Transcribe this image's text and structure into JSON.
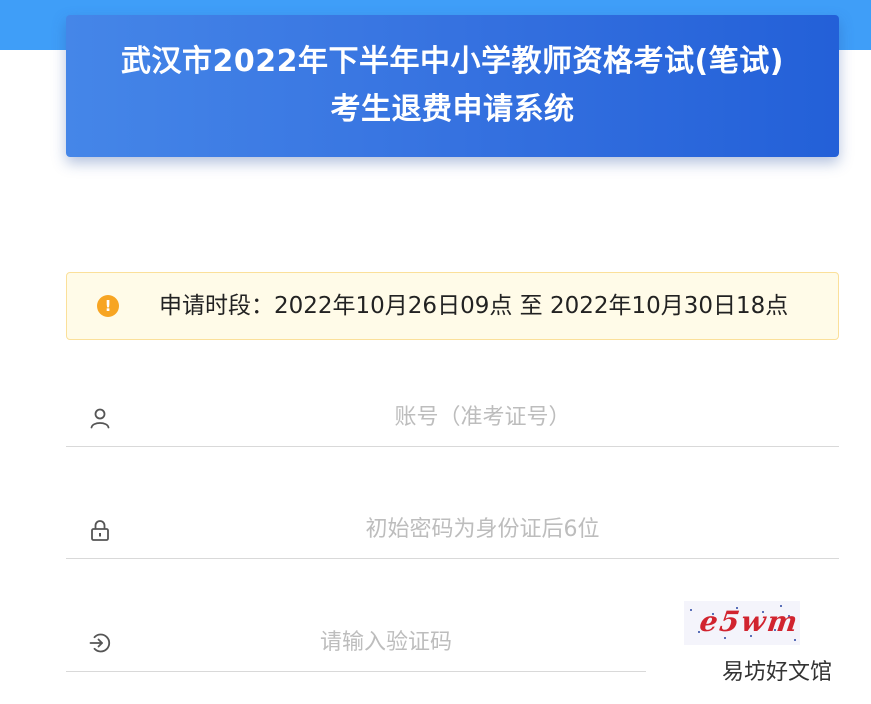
{
  "header": {
    "title_line1": "武汉市2022年下半年中小学教师资格考试(笔试)",
    "title_line2": "考生退费申请系统"
  },
  "notice": {
    "icon": "warning-circle-icon",
    "text": "申请时段：2022年10月26日09点 至 2022年10月30日18点"
  },
  "form": {
    "account": {
      "icon": "user-icon",
      "value": "",
      "placeholder": "账号（准考证号）"
    },
    "password": {
      "icon": "lock-icon",
      "value": "",
      "placeholder": "初始密码为身份证后6位"
    },
    "captcha": {
      "icon": "login-arrow-icon",
      "value": "",
      "placeholder": "请输入验证码",
      "image_text": "e5wm"
    }
  },
  "watermark": {
    "text": "易坊好文馆"
  },
  "colors": {
    "top_band": "#3f9ef8",
    "title_gradient_start": "#4586e8",
    "title_gradient_end": "#2360d8",
    "notice_bg": "#fffbe8",
    "notice_border": "#fbe09a",
    "warning": "#f7a523",
    "captcha_text": "#d1242f"
  }
}
